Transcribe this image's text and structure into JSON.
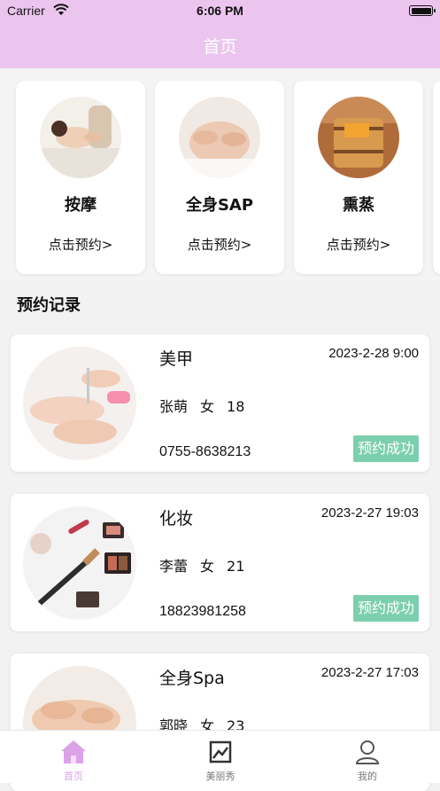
{
  "status_bar": {
    "carrier": "Carrier",
    "time": "6:06 PM"
  },
  "nav": {
    "title": "首页"
  },
  "services": [
    {
      "name": "按摩",
      "action": "点击预约>",
      "image": "massage-photo"
    },
    {
      "name": "全身SAP",
      "action": "点击预约>",
      "image": "spa-photo"
    },
    {
      "name": "熏蒸",
      "action": "点击预约>",
      "image": "steam-barrel-photo"
    }
  ],
  "records_title": "预约记录",
  "records": [
    {
      "service": "美甲",
      "time": "2023-2-28 9:00",
      "name": "张萌",
      "gender": "女",
      "age": "18",
      "phone": "0755-8638213",
      "status": "预约成功"
    },
    {
      "service": "化妆",
      "time": "2023-2-27 19:03",
      "name": "李蕾",
      "gender": "女",
      "age": "21",
      "phone": "18823981258",
      "status": "预约成功"
    },
    {
      "service": "全身Spa",
      "time": "2023-2-27 17:03",
      "name": "郭晓",
      "gender": "女",
      "age": "23",
      "phone": "",
      "status": ""
    }
  ],
  "tabs": [
    {
      "label": "首页",
      "icon": "home-icon",
      "active": true
    },
    {
      "label": "美丽秀",
      "icon": "image-icon",
      "active": false
    },
    {
      "label": "我的",
      "icon": "user-icon",
      "active": false
    }
  ],
  "colors": {
    "header": "#ecc5ef",
    "status_badge": "#7bcfae",
    "tab_active": "#dba3e6"
  }
}
